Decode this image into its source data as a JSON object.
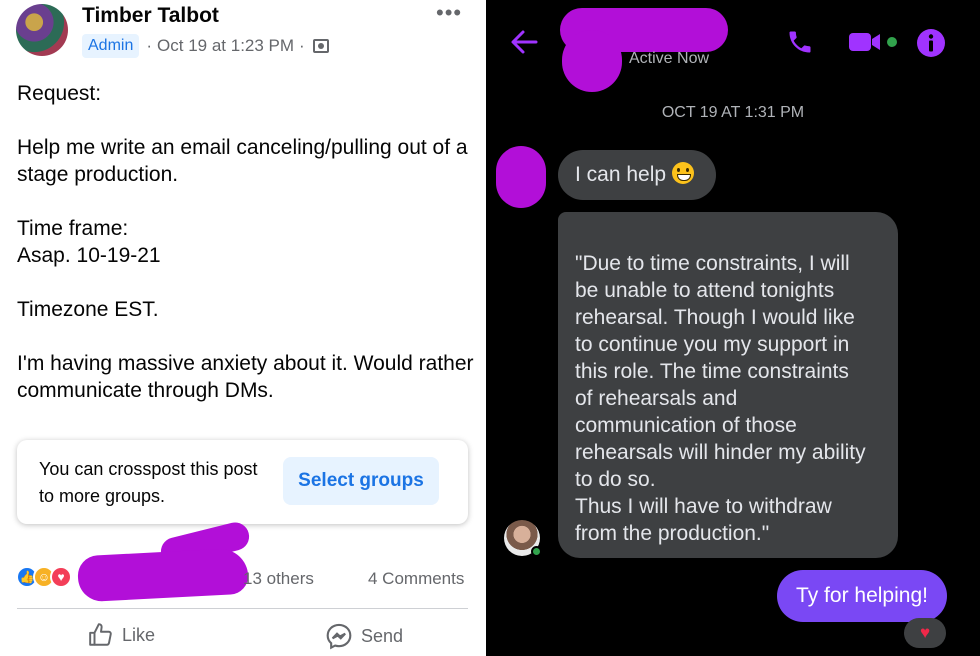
{
  "fb_post": {
    "author": "Timber Talbot",
    "role_badge": "Admin",
    "timestamp": "Oct 19 at 1:23 PM",
    "separator": "·",
    "more_icon": "more-options-icon",
    "body": {
      "request_label": "Request:",
      "request_text": "Help me write an email canceling/pulling out of a stage production.",
      "time_frame_label": "Time frame:",
      "time_frame_value": "Asap. 10-19-21",
      "timezone": "Timezone EST.",
      "anxiety_text": "I'm having massive anxiety about it.   Would rather communicate through DMs."
    },
    "crosspost": {
      "text": "You can crosspost this post to more groups.",
      "button_label": "Select groups"
    },
    "reactions_summary": "13 others",
    "comments_count": "4 Comments",
    "actions": {
      "like": "Like",
      "send": "Send"
    },
    "colors": {
      "accent": "#1b74e4",
      "redaction": "#b20fd8"
    }
  },
  "messenger": {
    "status": "Active Now",
    "header_icons": [
      "back-arrow-icon",
      "phone-icon",
      "video-icon",
      "info-icon"
    ],
    "timestamp": "OCT 19 AT 1:31 PM",
    "messages": [
      {
        "text": "I can help"
      },
      {
        "lines": [
          "\"Due to time constraints, I will",
          "be unable to attend tonights",
          "rehearsal.  Though I would like",
          "to continue you my support in",
          "this role.  The time constraints",
          "of rehearsals and",
          "communication of those",
          "rehearsals will hinder my ability",
          "to do so.",
          "Thus I will have to withdraw",
          "from the production.\""
        ]
      }
    ],
    "reply": "Ty for helping!",
    "reply_reaction": "♥",
    "colors": {
      "accent": "#a033ff",
      "my_bubble": "#7a48f4",
      "their_bubble": "#3e4042"
    }
  }
}
